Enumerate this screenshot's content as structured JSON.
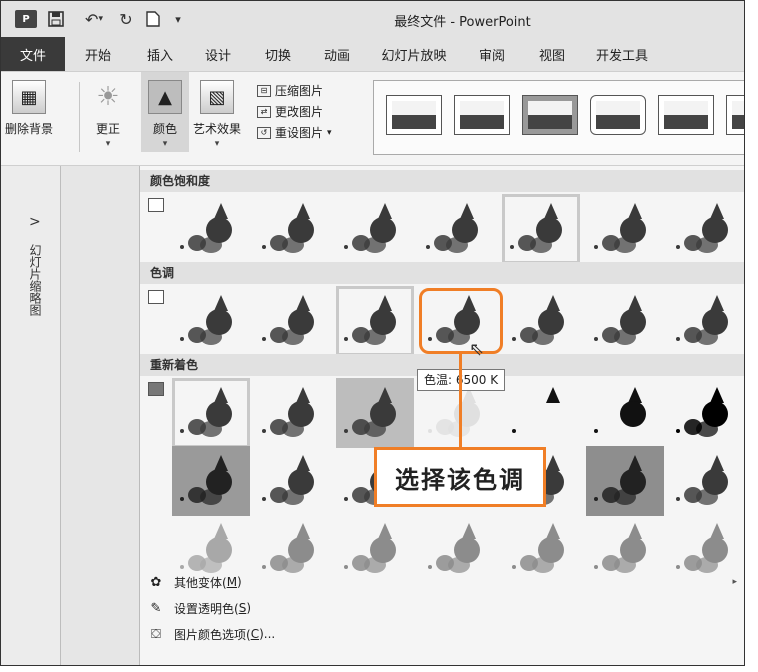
{
  "titlebar": {
    "app_icon": "P",
    "title": "最终文件 - PowerPoint"
  },
  "tabs": [
    "文件",
    "开始",
    "插入",
    "设计",
    "切换",
    "动画",
    "幻灯片放映",
    "审阅",
    "视图",
    "开发工具"
  ],
  "ribbon": {
    "remove_bg": "删除背景",
    "corrections": "更正",
    "color": "颜色",
    "artistic": "艺术效果",
    "compress": "压缩图片",
    "change": "更改图片",
    "reset": "重设图片"
  },
  "leftpane": {
    "chevron": ">",
    "label": "幻灯片缩略图"
  },
  "gallery": {
    "saturation_header": "颜色饱和度",
    "tone_header": "色调",
    "recolor_header": "重新着色",
    "tooltip": "色温: 6500 K",
    "callout": "选择该色调",
    "more_variants": "其他变体(",
    "more_variants_key": "M",
    "set_transparent": "设置透明色(",
    "set_transparent_key": "S",
    "color_options": "图片颜色选项(",
    "color_options_key": "C",
    "close_paren": ")",
    "ellipsis": ")..."
  },
  "colors": {
    "accent": "#f07e26",
    "file_tab": "#3a3a3a"
  }
}
